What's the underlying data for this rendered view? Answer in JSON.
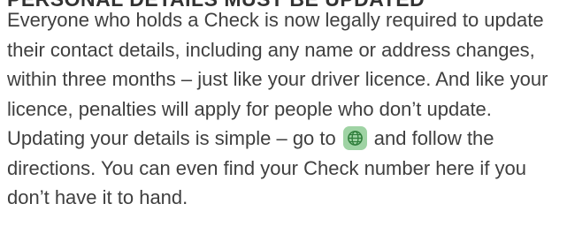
{
  "heading": "PERSONAL DETAILS MUST BE UPDATED",
  "paragraph": {
    "before_icon": "Everyone who holds a Check is now legally required to update their contact details, including any name or address changes, within three months – just like your driver licence. And like your licence, penalties will apply for people who don’t update. Updating your details is simple – go to",
    "after_icon": "and follow the directions. You can even find your Check number here if you don’t have it to hand."
  },
  "icon": {
    "name": "globe-icon",
    "badge_color": "#9fd3a4",
    "stroke_color": "#2e7d3a"
  }
}
